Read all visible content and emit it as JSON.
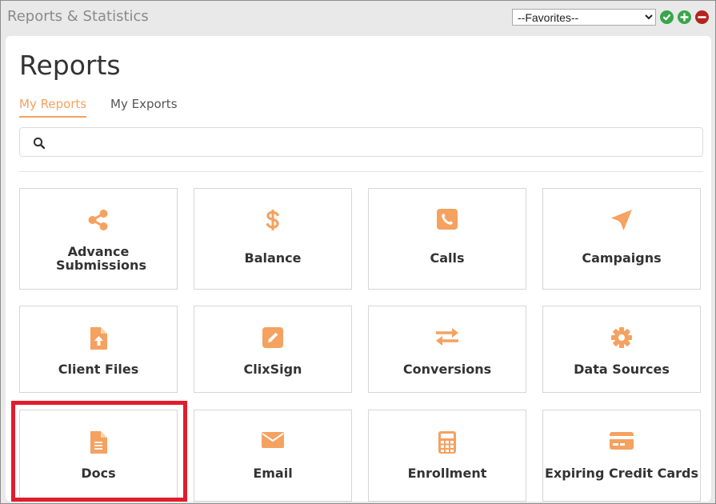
{
  "window": {
    "title": "Reports & Statistics",
    "favorites": {
      "selected": "--Favorites--",
      "options": [
        "--Favorites--"
      ]
    },
    "buttons": {
      "check": "check-circle-icon",
      "add": "plus-circle-icon",
      "remove": "minus-circle-icon"
    }
  },
  "page": {
    "title": "Reports",
    "tabs": [
      {
        "label": "My Reports",
        "active": true
      },
      {
        "label": "My Exports",
        "active": false
      }
    ],
    "search": {
      "value": "",
      "placeholder": ""
    }
  },
  "cards": [
    {
      "label": "Advance Submissions",
      "icon": "share-icon"
    },
    {
      "label": "Balance",
      "icon": "dollar-icon"
    },
    {
      "label": "Calls",
      "icon": "phone-icon"
    },
    {
      "label": "Campaigns",
      "icon": "paper-plane-icon"
    },
    {
      "label": "Client Files",
      "icon": "file-upload-icon"
    },
    {
      "label": "ClixSign",
      "icon": "edit-icon"
    },
    {
      "label": "Conversions",
      "icon": "exchange-icon"
    },
    {
      "label": "Data Sources",
      "icon": "gear-icon"
    },
    {
      "label": "Docs",
      "icon": "document-icon"
    },
    {
      "label": "Email",
      "icon": "envelope-icon"
    },
    {
      "label": "Enrollment",
      "icon": "calculator-icon"
    },
    {
      "label": "Expiring Credit Cards",
      "icon": "credit-card-icon"
    }
  ],
  "colors": {
    "accent": "#f5a160",
    "highlight": "#e11d2b"
  }
}
